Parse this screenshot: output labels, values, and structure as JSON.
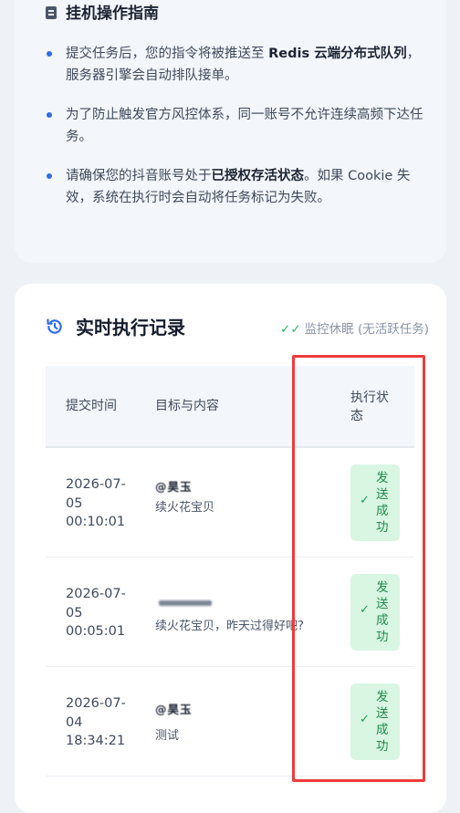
{
  "guide": {
    "title": "挂机操作指南",
    "bullets": [
      {
        "pre": "提交任务后，您的指令将被推送至 ",
        "bold": "Redis 云端分布式队列",
        "post": "，服务器引擎会自动排队接单。"
      },
      {
        "pre": "为了防止触发官方风控体系，同一账号不允许连续高频下达任务。",
        "bold": "",
        "post": ""
      },
      {
        "pre": "请确保您的抖音账号处于",
        "bold": "已授权存活状态",
        "post": "。如果 Cookie 失效，系统在执行时会自动将任务标记为失败。"
      }
    ]
  },
  "records": {
    "title": "实时执行记录",
    "monitor_status": "监控休眠 (无活跃任务)",
    "columns": {
      "time": "提交时间",
      "target": "目标与内容",
      "status": "执行状态"
    },
    "rows": [
      {
        "time": "2026-07-05 00:10:01",
        "target": "@昊玉",
        "content": "续火花宝贝",
        "status": "发送成功"
      },
      {
        "time": "2026-07-05 00:05:01",
        "target": "",
        "content": "续火花宝贝，昨天过得好吧?",
        "status": "发送成功"
      },
      {
        "time": "2026-07-04 18:34:21",
        "target": "@昊玉",
        "content": "测试",
        "status": "发送成功"
      }
    ]
  },
  "colors": {
    "accent": "#2f6bea",
    "success_bg": "#d9f6e3",
    "success_text": "#1d8c4b",
    "highlight": "#ee3b3b"
  }
}
